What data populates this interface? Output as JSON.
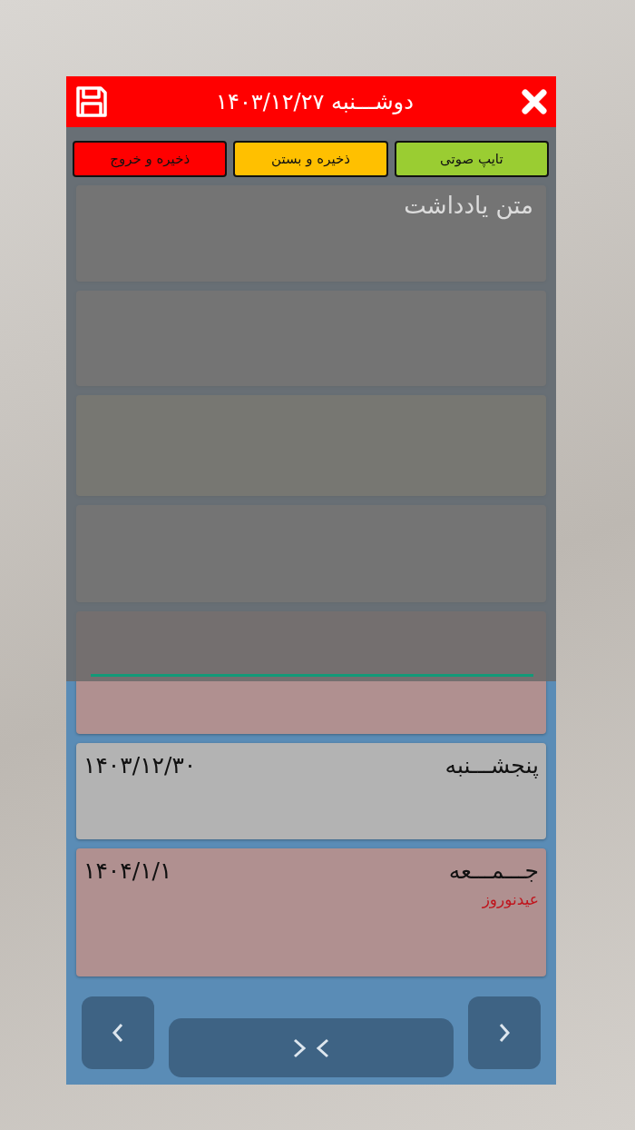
{
  "window": {
    "title": "دوشـــنبه ۱۴۰۳/۱۲/۲۷"
  },
  "actions": [
    {
      "label": "تایپ صوتی",
      "kind": "voice"
    },
    {
      "label": "ذخیره و بستن",
      "kind": "save_close"
    },
    {
      "label": "ذخیره و خروج",
      "kind": "save_exit"
    }
  ],
  "note": {
    "placeholder": "متن یادداشت"
  },
  "days": [
    {
      "kind": "normal"
    },
    {
      "kind": "normal"
    },
    {
      "kind": "today"
    },
    {
      "kind": "normal"
    },
    {
      "kind": "holiday"
    },
    {
      "day": "پنجشـــنبه",
      "date": "۱۴۰۳/۱۲/۳۰",
      "kind": "normal"
    },
    {
      "day": "جـــمـــعه",
      "date": "۱۴۰۴/۱/۱",
      "kind": "holiday",
      "event": "عیدنوروز"
    }
  ]
}
